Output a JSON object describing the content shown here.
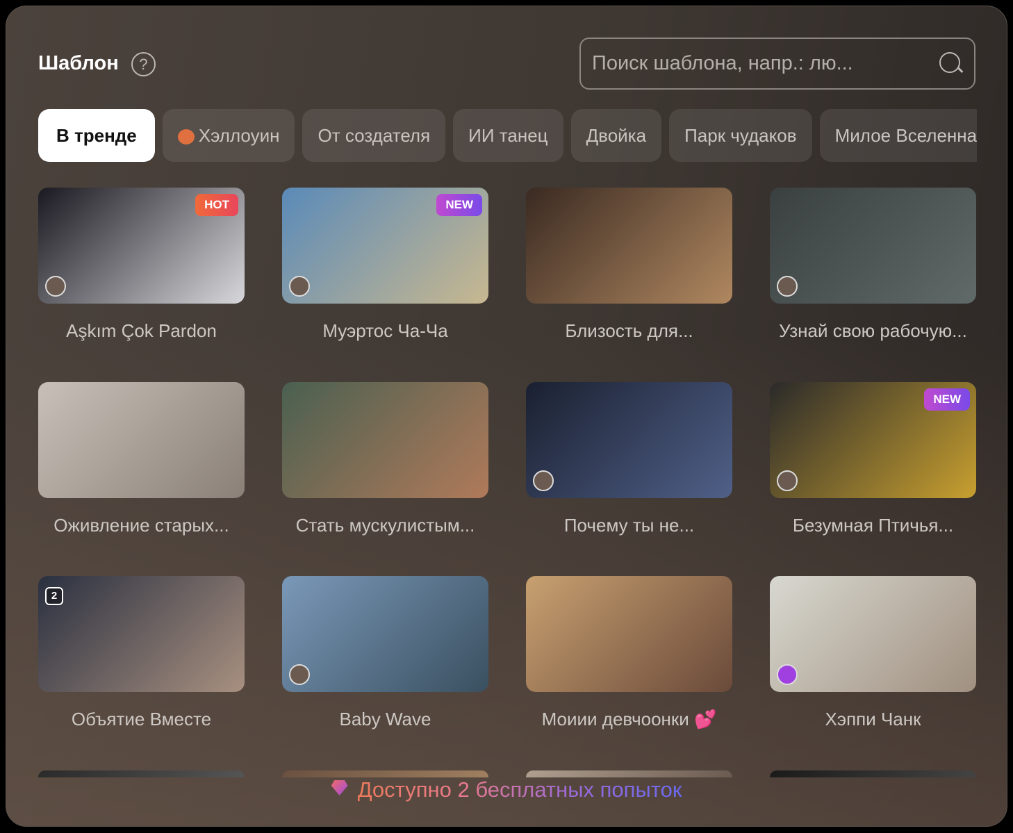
{
  "header": {
    "title": "Шаблон",
    "help_icon": "question-circle-icon",
    "search_placeholder": "Поиск шаблона, напр.: лю..."
  },
  "tabs": [
    {
      "label": "В тренде",
      "active": true
    },
    {
      "label": "Хэллоуин",
      "icon": "pumpkin-icon"
    },
    {
      "label": "От создателя"
    },
    {
      "label": "ИИ танец"
    },
    {
      "label": "Двойка"
    },
    {
      "label": "Парк чудаков"
    },
    {
      "label": "Милое Вселенная"
    }
  ],
  "templates": [
    {
      "title": "Aşkım Çok Pardon",
      "badge": "HOT",
      "colors": [
        "#1a1820",
        "#d8d8dc"
      ]
    },
    {
      "title": "Муэртос Ча-Ча",
      "badge": "NEW",
      "colors": [
        "#5a8ab8",
        "#c8b890"
      ]
    },
    {
      "title": "Близость для...",
      "colors": [
        "#3a2a22",
        "#b08860"
      ]
    },
    {
      "title": "Узнай свою рабочую...",
      "colors": [
        "#3a4040",
        "#606a68"
      ]
    },
    {
      "title": "Оживление старых...",
      "colors": [
        "#c8c0b8",
        "#8a8078"
      ]
    },
    {
      "title": "Стать мускулистым...",
      "colors": [
        "#4a6050",
        "#b07a5a"
      ]
    },
    {
      "title": "Почему ты не...",
      "colors": [
        "#1a2030",
        "#506088"
      ]
    },
    {
      "title": "Безумная Птичья...",
      "badge": "NEW",
      "colors": [
        "#2a2a2a",
        "#c8a030"
      ]
    },
    {
      "title": "Объятие Вместе",
      "count": "2",
      "colors": [
        "#2a3040",
        "#a89080"
      ]
    },
    {
      "title": "Baby Wave",
      "colors": [
        "#7a98b8",
        "#3a5060"
      ]
    },
    {
      "title": "Моиии девчоонки 💕",
      "colors": [
        "#c8a070",
        "#6a4a3a"
      ]
    },
    {
      "title": "Хэппи Чанк",
      "colors": [
        "#d8d8d0",
        "#a09080"
      ]
    },
    {
      "title": "",
      "colors": [
        "#2a2a2a",
        "#555"
      ]
    },
    {
      "title": "",
      "colors": [
        "#6a5040",
        "#a08060"
      ]
    },
    {
      "title": "",
      "colors": [
        "#b0a090",
        "#6a5a50"
      ]
    },
    {
      "title": "",
      "colors": [
        "#1a1a1a",
        "#444"
      ]
    }
  ],
  "footer": {
    "text": "Доступно 2 бесплатных попыток",
    "icon": "gem-icon"
  }
}
